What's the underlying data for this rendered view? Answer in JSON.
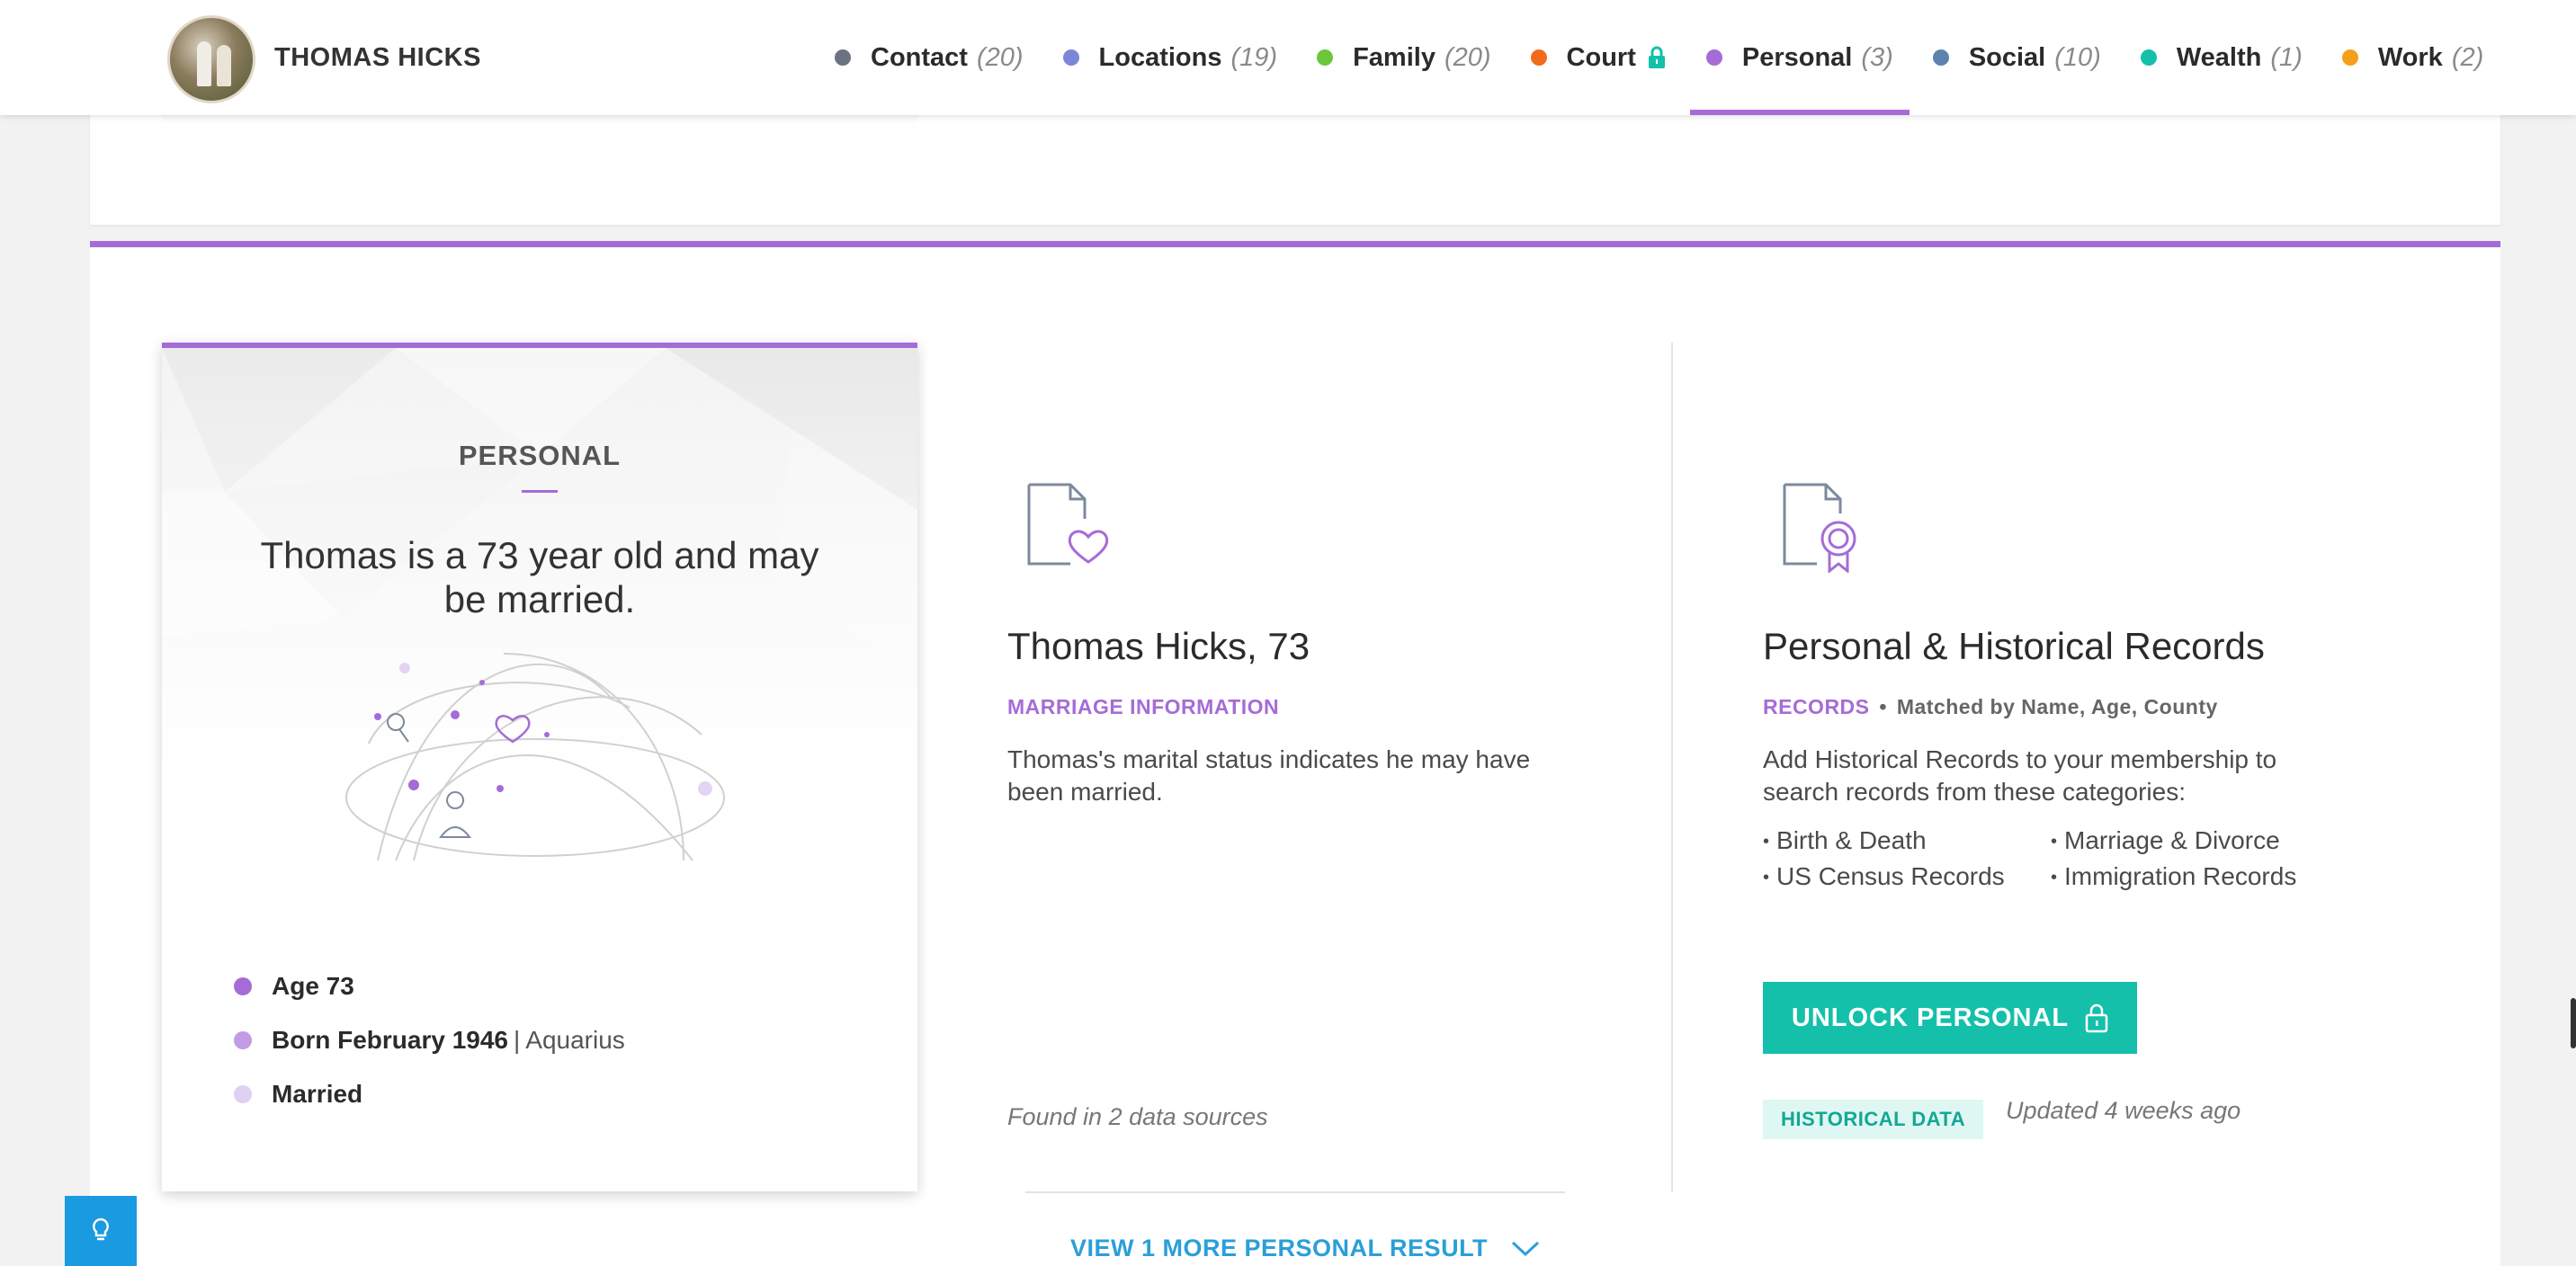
{
  "header": {
    "person_name": "THOMAS HICKS",
    "nav": [
      {
        "label": "Contact",
        "count": "(20)",
        "color": "#6b7280",
        "active": false,
        "locked": false
      },
      {
        "label": "Locations",
        "count": "(19)",
        "color": "#7c86d9",
        "active": false,
        "locked": false
      },
      {
        "label": "Family",
        "count": "(20)",
        "color": "#6cc63a",
        "active": false,
        "locked": false
      },
      {
        "label": "Court",
        "count": "",
        "color": "#f26b1d",
        "active": false,
        "locked": true
      },
      {
        "label": "Personal",
        "count": "(3)",
        "color": "#a56cd6",
        "active": true,
        "locked": false
      },
      {
        "label": "Social",
        "count": "(10)",
        "color": "#5a84ad",
        "active": false,
        "locked": false
      },
      {
        "label": "Wealth",
        "count": "(1)",
        "color": "#14c0aa",
        "active": false,
        "locked": false
      },
      {
        "label": "Work",
        "count": "(2)",
        "color": "#f5a01a",
        "active": false,
        "locked": false
      }
    ]
  },
  "summary": {
    "title": "PERSONAL",
    "text": "Thomas is a 73 year old and may be married.",
    "facts": [
      {
        "strong": "Age 73",
        "sep": "",
        "extra": "",
        "color": "#a56cd6"
      },
      {
        "strong": "Born February 1946",
        "sep": "|",
        "extra": "Aquarius",
        "color": "#c39be6"
      },
      {
        "strong": "Married",
        "sep": "",
        "extra": "",
        "color": "#e2d0f2"
      }
    ]
  },
  "marriage": {
    "title": "Thomas Hicks, 73",
    "subtitle": "MARRIAGE INFORMATION",
    "description": "Thomas's marital status indicates he may have been married.",
    "found": "Found in 2 data sources"
  },
  "records": {
    "title": "Personal & Historical Records",
    "subtitle_accent": "RECORDS",
    "subtitle_dot": "•",
    "subtitle_rest": "Matched by Name, Age, County",
    "description": "Add Historical Records to your membership to search records from these categories:",
    "categories": [
      "Birth & Death",
      "Marriage & Divorce",
      "US Census Records",
      "Immigration Records"
    ],
    "unlock_label": "UNLOCK PERSONAL",
    "badge": "HISTORICAL DATA",
    "updated": "Updated 4 weeks ago"
  },
  "more": {
    "label": "VIEW 1 MORE PERSONAL RESULT"
  },
  "colors": {
    "accent": "#a56cd6",
    "teal": "#14c0aa",
    "link": "#2a9fd8"
  }
}
